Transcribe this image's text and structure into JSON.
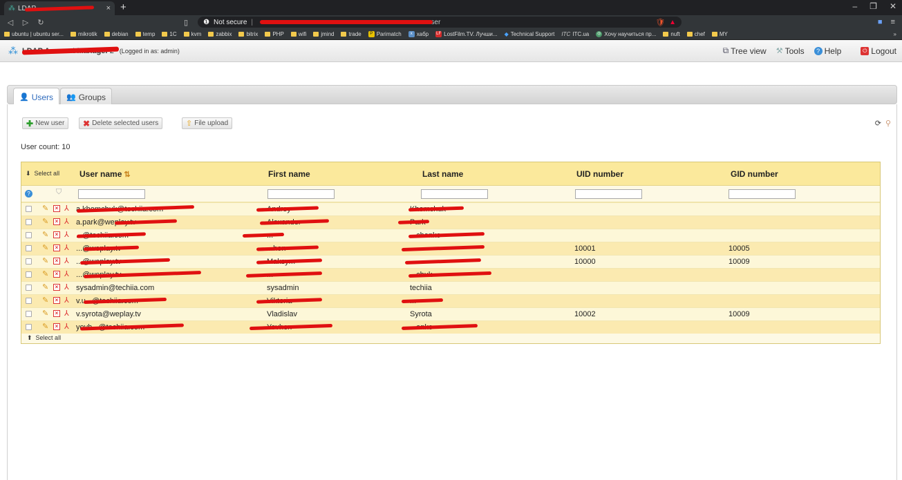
{
  "browser": {
    "tab_title": "LDAP ...",
    "tab_close": "×",
    "new_tab": "+",
    "not_secure": "Not secure",
    "url_tail": "=user",
    "bookmarks": [
      "ubuntu | ubuntu ser...",
      "mikrotik",
      "debian",
      "temp",
      "1C",
      "kvm",
      "zabbix",
      "bitrix",
      "PHP",
      "wifi",
      "jmind",
      "trade",
      "Parimatch",
      "хабр",
      "LostFilm.TV. Лучши...",
      "Technical Support",
      "ITC.ua",
      "Хочу научиться пр...",
      "nuft",
      "chef",
      "MY"
    ],
    "bookmarks_more": "»"
  },
  "header": {
    "app_title": "LDAP Account Manager",
    "version": "2",
    "logged_in": "(Logged in as: admin)",
    "links": {
      "tree_view": "Tree view",
      "tools": "Tools",
      "help": "Help",
      "logout": "Logout"
    }
  },
  "tabs": [
    {
      "label": "Users",
      "active": true
    },
    {
      "label": "Groups",
      "active": false
    }
  ],
  "actions": {
    "new_user": "New user",
    "delete_selected": "Delete selected users",
    "file_upload": "File upload"
  },
  "user_count": "User count: 10",
  "table": {
    "select_all": "Select all",
    "columns": [
      "User name",
      "First name",
      "Last name",
      "UID number",
      "GID number"
    ],
    "rows": [
      {
        "user": "a.khomchuk@techiia.com",
        "first": "Andrey",
        "last": "Khomchuk",
        "uid": "",
        "gid": ""
      },
      {
        "user": "a.park@weplay.tv",
        "first": "Alexander",
        "last": "Park",
        "uid": "",
        "gid": ""
      },
      {
        "user": "...@techiia.com",
        "first": "...",
        "last": "...chenko",
        "uid": "",
        "gid": ""
      },
      {
        "user": "...@weplay.tv",
        "first": "...hon",
        "last": "...",
        "uid": "10001",
        "gid": "10005"
      },
      {
        "user": "...@weplay.tv",
        "first": "Maksym",
        "last": "...",
        "uid": "10000",
        "gid": "10009"
      },
      {
        "user": "...@weplay.tv",
        "first": "...",
        "last": "...chuk",
        "uid": "",
        "gid": ""
      },
      {
        "user": "sysadmin@techiia.com",
        "first": "sysadmin",
        "last": "techiia",
        "uid": "",
        "gid": ""
      },
      {
        "user": "v.u...@techiia.com",
        "first": "Viktoria",
        "last": "...",
        "uid": "",
        "gid": ""
      },
      {
        "user": "v.syrota@weplay.tv",
        "first": "Vladislav",
        "last": "Syrota",
        "uid": "10002",
        "gid": "10009"
      },
      {
        "user": "yevh...@techiia.com",
        "first": "Yevhen",
        "last": "...enko",
        "uid": "",
        "gid": ""
      }
    ]
  },
  "colors": {
    "header_bg": "#fbe99c",
    "row_odd": "#fdf7d8",
    "row_even": "#fbeab0",
    "accent": "#2f6bbd",
    "redaction": "#e01010"
  }
}
